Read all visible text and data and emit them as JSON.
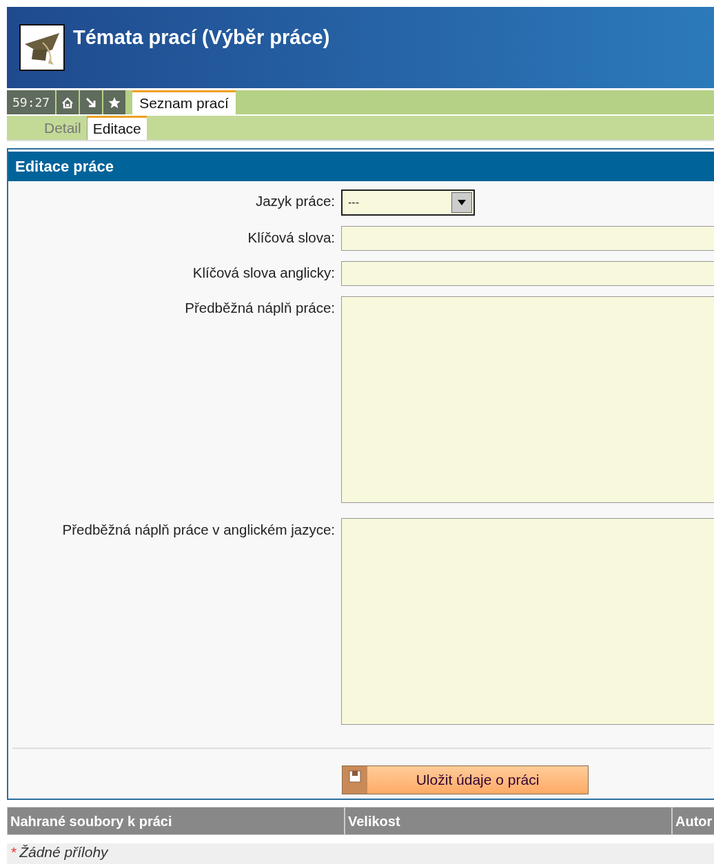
{
  "header": {
    "title": "Témata prací (Výběr práce)"
  },
  "toolbar": {
    "timer": "59:27",
    "tabs": [
      {
        "label": "Seznam prací",
        "selected": true
      }
    ]
  },
  "subtabs": [
    {
      "label": "Detail",
      "selected": false
    },
    {
      "label": "Editace",
      "selected": true
    }
  ],
  "form": {
    "title": "Editace práce",
    "fields": [
      {
        "kind": "select",
        "label": "Jazyk práce:",
        "value": "---"
      },
      {
        "kind": "input",
        "label": "Klíčová slova:"
      },
      {
        "kind": "input",
        "label": "Klíčová slova anglicky:"
      },
      {
        "kind": "textarea",
        "label": "Předběžná náplň práce:"
      },
      {
        "kind": "textarea",
        "label": "Předběžná náplň práce v anglickém jazyce:"
      }
    ],
    "save_button": "Uložit údaje o práci"
  },
  "files": {
    "columns": [
      "Nahrané soubory k práci",
      "Velikost",
      "Autor"
    ],
    "empty_marker": "*",
    "empty_text": "Žádné přílohy"
  }
}
